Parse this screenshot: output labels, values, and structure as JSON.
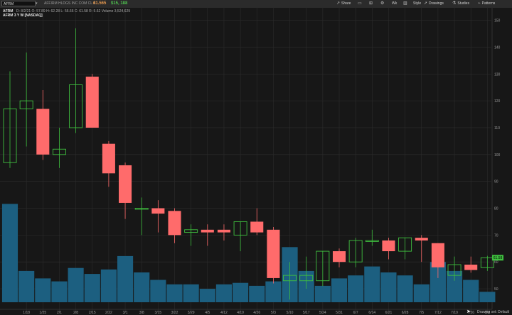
{
  "toolbar": {
    "symbol": "AFRM",
    "company": "AFFIRM HLDGS INC COM CL A",
    "last": "61.565",
    "change": "$15, 188",
    "buttons": [
      {
        "label": "Share",
        "icon": "share-icon"
      },
      {
        "label": "",
        "icon": "layout-icon"
      },
      {
        "label": "",
        "icon": "grid-icon"
      },
      {
        "label": "",
        "icon": "gear-icon"
      },
      {
        "label": "Wk",
        "icon": ""
      },
      {
        "label": "",
        "icon": "bar-chart-icon"
      },
      {
        "label": "Style",
        "icon": "pencil-icon"
      },
      {
        "label": "Drawings",
        "icon": "cursor-icon"
      },
      {
        "label": "Studies",
        "icon": "flask-icon"
      },
      {
        "label": "Patterns",
        "icon": "patterns-icon"
      }
    ]
  },
  "chart_label": {
    "ticker": "AFRM",
    "d": "D: 8/2/21",
    "o": "O: 57.89",
    "h": "H: 62.28",
    "l": "L: 56.66",
    "c": "C: 61.58",
    "r": "R: 5.62",
    "volume_label": "Volume",
    "volume": "3,524,629",
    "title": "AFRM 3 Y W [NASDAQ]"
  },
  "footer": {
    "drawing_set": "Drawing set: Default"
  },
  "colors": {
    "up": "#3fbf3f",
    "down": "#ff6b6b",
    "volume": "#1c5f80",
    "grid": "#2c2c2c",
    "bg": "#171717"
  },
  "chart_data": {
    "type": "candlestick",
    "y_axis": {
      "ticks": [
        50,
        60,
        70,
        80,
        90,
        100,
        110,
        120,
        130,
        140,
        150
      ],
      "range": [
        45,
        152
      ]
    },
    "x_ticks": [
      "1/18",
      "1/25",
      "2/1",
      "2/8",
      "2/15",
      "2/22",
      "3/1",
      "3/8",
      "3/15",
      "3/22",
      "3/29",
      "4/5",
      "4/12",
      "4/19",
      "4/26",
      "5/3",
      "5/10",
      "5/17",
      "5/24",
      "5/31",
      "6/7",
      "6/14",
      "6/21",
      "6/28",
      "7/5",
      "7/12",
      "7/19",
      "7/26",
      "8/2"
    ],
    "last_price_tag": "61.58",
    "candles": [
      {
        "x": "1/11",
        "o": 97,
        "h": 131,
        "l": 95,
        "c": 117
      },
      {
        "x": "1/18",
        "o": 117,
        "h": 138,
        "l": 103,
        "c": 120
      },
      {
        "x": "1/25",
        "o": 117,
        "h": 124,
        "l": 98,
        "c": 100
      },
      {
        "x": "2/1",
        "o": 100,
        "h": 110,
        "l": 95,
        "c": 102
      },
      {
        "x": "2/8",
        "o": 110,
        "h": 147,
        "l": 108,
        "c": 126
      },
      {
        "x": "2/15",
        "o": 129,
        "h": 130,
        "l": 110,
        "c": 110
      },
      {
        "x": "2/22",
        "o": 104,
        "h": 105,
        "l": 88,
        "c": 93
      },
      {
        "x": "3/1",
        "o": 96,
        "h": 97,
        "l": 76,
        "c": 82
      },
      {
        "x": "3/8",
        "o": 80,
        "h": 84,
        "l": 70,
        "c": 80
      },
      {
        "x": "3/15",
        "o": 80,
        "h": 83,
        "l": 71,
        "c": 78
      },
      {
        "x": "3/22",
        "o": 79,
        "h": 80,
        "l": 67,
        "c": 70
      },
      {
        "x": "3/29",
        "o": 71,
        "h": 74,
        "l": 66,
        "c": 72
      },
      {
        "x": "4/5",
        "o": 72,
        "h": 74,
        "l": 66,
        "c": 71
      },
      {
        "x": "4/12",
        "o": 72,
        "h": 74,
        "l": 68,
        "c": 71
      },
      {
        "x": "4/19",
        "o": 70,
        "h": 75,
        "l": 64,
        "c": 75
      },
      {
        "x": "4/26",
        "o": 75,
        "h": 80,
        "l": 70,
        "c": 71
      },
      {
        "x": "5/3",
        "o": 72,
        "h": 73,
        "l": 52,
        "c": 54
      },
      {
        "x": "5/10",
        "o": 53,
        "h": 60,
        "l": 46,
        "c": 55
      },
      {
        "x": "5/17",
        "o": 53,
        "h": 62,
        "l": 50,
        "c": 55
      },
      {
        "x": "5/24",
        "o": 53,
        "h": 64,
        "l": 51,
        "c": 64
      },
      {
        "x": "5/31",
        "o": 64,
        "h": 65,
        "l": 58,
        "c": 60
      },
      {
        "x": "6/7",
        "o": 60,
        "h": 69,
        "l": 58,
        "c": 68
      },
      {
        "x": "6/14",
        "o": 68,
        "h": 72,
        "l": 66,
        "c": 68
      },
      {
        "x": "6/21",
        "o": 68,
        "h": 69,
        "l": 61,
        "c": 64
      },
      {
        "x": "6/28",
        "o": 64,
        "h": 69,
        "l": 61,
        "c": 69
      },
      {
        "x": "7/5",
        "o": 69,
        "h": 70,
        "l": 60,
        "c": 68
      },
      {
        "x": "7/12",
        "o": 67,
        "h": 67,
        "l": 54,
        "c": 58
      },
      {
        "x": "7/19",
        "o": 55,
        "h": 62,
        "l": 53,
        "c": 59
      },
      {
        "x": "7/26",
        "o": 59,
        "h": 62,
        "l": 56,
        "c": 57
      },
      {
        "x": "8/2",
        "o": 57.89,
        "h": 62.28,
        "l": 56.66,
        "c": 61.58
      }
    ],
    "volume": [
      0.66,
      0.21,
      0.16,
      0.14,
      0.23,
      0.19,
      0.22,
      0.31,
      0.2,
      0.15,
      0.12,
      0.12,
      0.09,
      0.12,
      0.13,
      0.11,
      0.14,
      0.37,
      0.21,
      0.11,
      0.16,
      0.18,
      0.24,
      0.2,
      0.18,
      0.12,
      0.27,
      0.21,
      0.15,
      0.07
    ]
  }
}
